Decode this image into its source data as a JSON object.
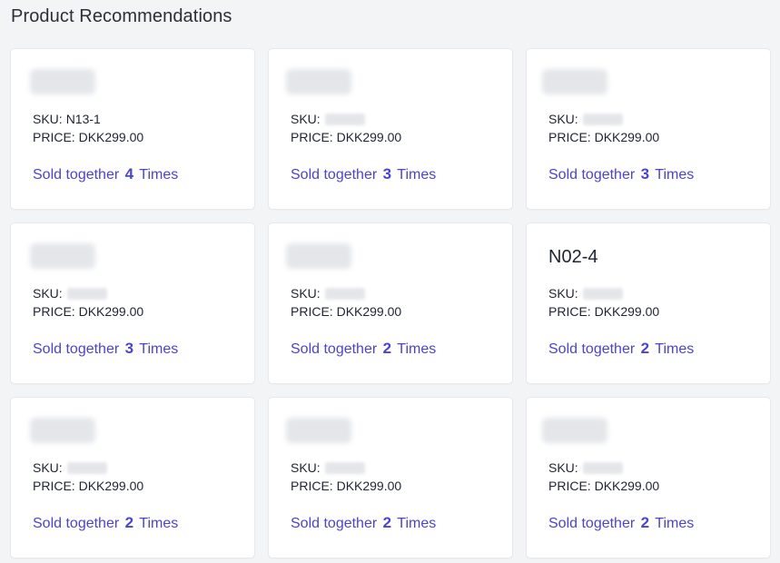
{
  "page": {
    "title": "Product Recommendations"
  },
  "labels": {
    "sku": "SKU:",
    "price": "PRICE:",
    "sold_prefix": "Sold together",
    "sold_suffix": "Times"
  },
  "colors": {
    "link": "#4b44cc",
    "card_background": "#ffffff",
    "page_background": "#f3f4f6"
  },
  "cards": [
    {
      "name": "",
      "name_blurred": true,
      "sku": "N13-1",
      "sku_blurred": false,
      "price": "DKK299.00",
      "count": "4"
    },
    {
      "name": "",
      "name_blurred": true,
      "sku": "",
      "sku_blurred": true,
      "price": "DKK299.00",
      "count": "3"
    },
    {
      "name": "",
      "name_blurred": true,
      "sku": "",
      "sku_blurred": true,
      "price": "DKK299.00",
      "count": "3"
    },
    {
      "name": "",
      "name_blurred": true,
      "sku": "",
      "sku_blurred": true,
      "price": "DKK299.00",
      "count": "3"
    },
    {
      "name": "",
      "name_blurred": true,
      "sku": "",
      "sku_blurred": true,
      "price": "DKK299.00",
      "count": "2"
    },
    {
      "name": "N02-4",
      "name_blurred": false,
      "sku": "",
      "sku_blurred": true,
      "price": "DKK299.00",
      "count": "2"
    },
    {
      "name": "",
      "name_blurred": true,
      "sku": "",
      "sku_blurred": true,
      "price": "DKK299.00",
      "count": "2"
    },
    {
      "name": "",
      "name_blurred": true,
      "sku": "",
      "sku_blurred": true,
      "price": "DKK299.00",
      "count": "2"
    },
    {
      "name": "",
      "name_blurred": true,
      "sku": "",
      "sku_blurred": true,
      "price": "DKK299.00",
      "count": "2"
    }
  ]
}
